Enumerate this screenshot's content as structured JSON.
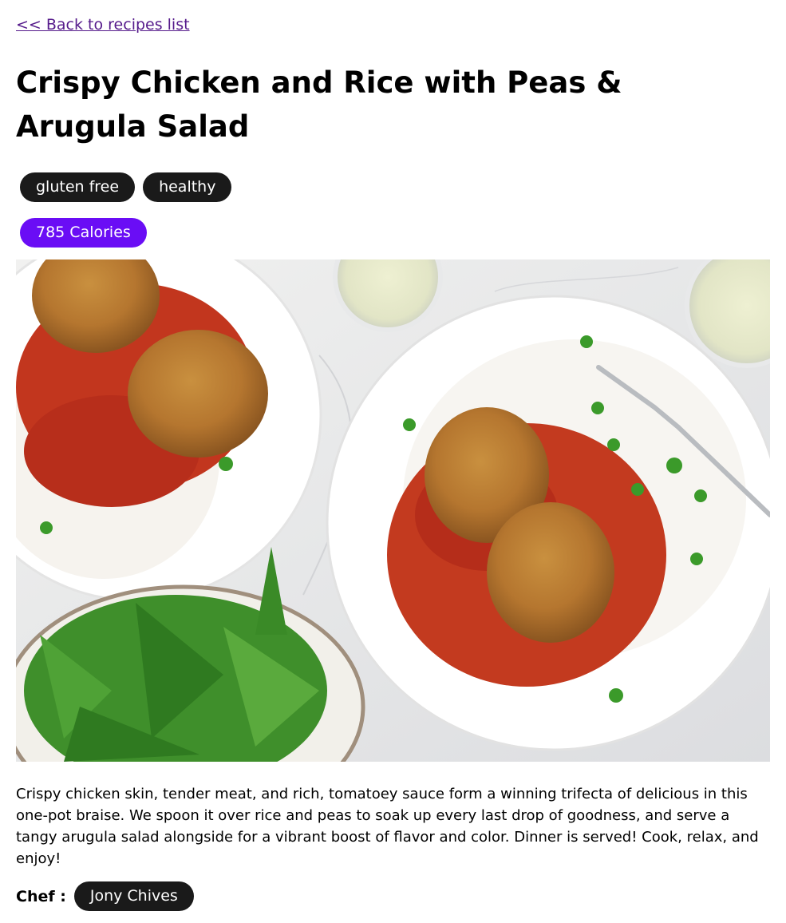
{
  "nav": {
    "back_label": "<< Back to recipes list"
  },
  "recipe": {
    "title": "Crispy Chicken and Rice with Peas & Arugula Salad",
    "tags": [
      "gluten free",
      "healthy"
    ],
    "calories_label": "785 Calories",
    "description": "Crispy chicken skin, tender meat, and rich, tomatoey sauce form a winning trifecta of delicious in this one-pot braise. We spoon it over rice and peas to soak up every last drop of goodness, and serve a tangy arugula salad alongside for a vibrant boost of flavor and color. Dinner is served! Cook, relax, and enjoy!",
    "chef_label": "Chef :",
    "chef_name": "Jony Chives"
  },
  "colors": {
    "tag_bg": "#1a1a1a",
    "calories_bg": "#6a0df5",
    "link": "#551a8b"
  }
}
